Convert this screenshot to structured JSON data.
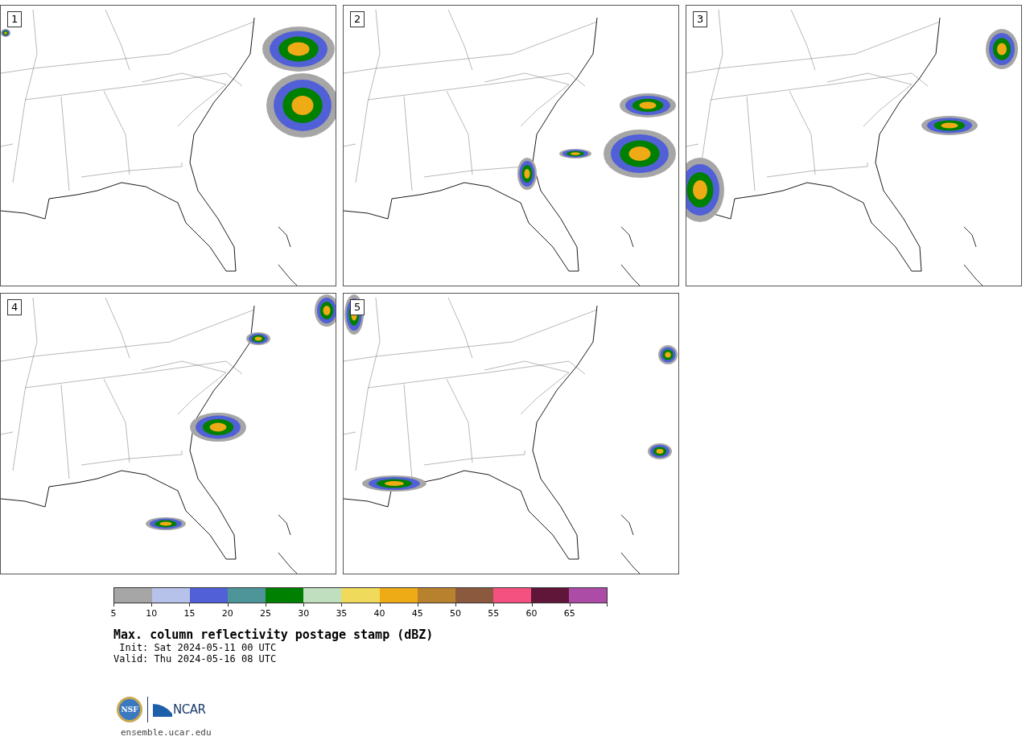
{
  "panels": [
    {
      "label": "1"
    },
    {
      "label": "2"
    },
    {
      "label": "3"
    },
    {
      "label": "4"
    },
    {
      "label": "5"
    }
  ],
  "colorbar": {
    "bins": [
      {
        "color": "#a6a6a6"
      },
      {
        "color": "#b7c2ea"
      },
      {
        "color": "#5160d6"
      },
      {
        "color": "#4e9599"
      },
      {
        "color": "#008000"
      },
      {
        "color": "#bfdfbf"
      },
      {
        "color": "#f0da5c"
      },
      {
        "color": "#efab16"
      },
      {
        "color": "#b8812e"
      },
      {
        "color": "#8b5a3e"
      },
      {
        "color": "#f45180"
      },
      {
        "color": "#601638"
      },
      {
        "color": "#ac4ca6"
      }
    ],
    "tick_labels": [
      "5",
      "10",
      "15",
      "20",
      "25",
      "30",
      "35",
      "40",
      "45",
      "50",
      "55",
      "60",
      "65"
    ]
  },
  "title": "Max. column reflectivity postage stamp (dBZ)",
  "init": " Init: Sat 2024-05-11 00 UTC",
  "valid": "Valid: Thu 2024-05-16 08 UTC",
  "logo": {
    "seal_text": "NSF",
    "wordmark": "NCAR"
  },
  "footer_url": "ensemble.ucar.edu"
}
